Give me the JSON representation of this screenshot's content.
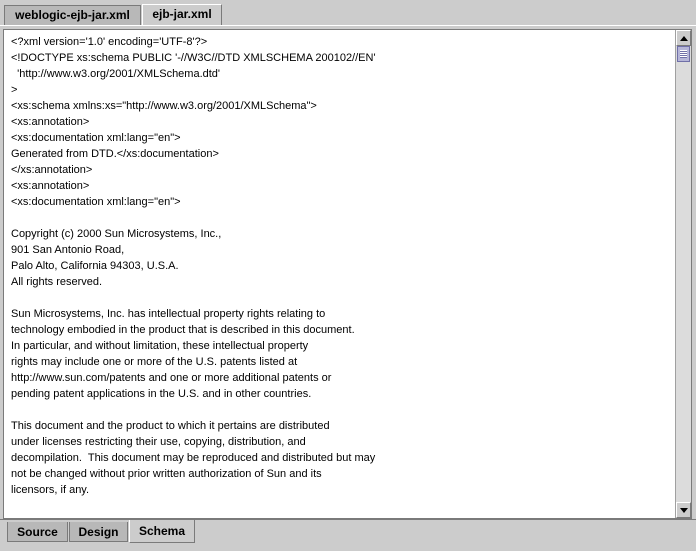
{
  "top_tabs": [
    {
      "label": "weblogic-ejb-jar.xml",
      "selected": false
    },
    {
      "label": "ejb-jar.xml",
      "selected": true
    }
  ],
  "editor": {
    "lines": [
      "<?xml version='1.0' encoding='UTF-8'?>",
      "<!DOCTYPE xs:schema PUBLIC '-//W3C//DTD XMLSCHEMA 200102//EN'",
      "  'http://www.w3.org/2001/XMLSchema.dtd'",
      ">",
      "<xs:schema xmlns:xs=\"http://www.w3.org/2001/XMLSchema\">",
      "<xs:annotation>",
      "<xs:documentation xml:lang=\"en\">",
      "Generated from DTD.</xs:documentation>",
      "</xs:annotation>",
      "<xs:annotation>",
      "<xs:documentation xml:lang=\"en\">",
      "",
      "Copyright (c) 2000 Sun Microsystems, Inc.,",
      "901 San Antonio Road,",
      "Palo Alto, California 94303, U.S.A.",
      "All rights reserved.",
      "",
      "Sun Microsystems, Inc. has intellectual property rights relating to",
      "technology embodied in the product that is described in this document.",
      "In particular, and without limitation, these intellectual property",
      "rights may include one or more of the U.S. patents listed at",
      "http://www.sun.com/patents and one or more additional patents or",
      "pending patent applications in the U.S. and in other countries.",
      "",
      "This document and the product to which it pertains are distributed",
      "under licenses restricting their use, copying, distribution, and",
      "decompilation.  This document may be reproduced and distributed but may",
      "not be changed without prior written authorization of Sun and its",
      "licensors, if any."
    ]
  },
  "scrollbar": {
    "up_icon": "arrow-up-icon",
    "down_icon": "arrow-down-icon"
  },
  "bottom_tabs": [
    {
      "label": "Source",
      "selected": false
    },
    {
      "label": "Design",
      "selected": false
    },
    {
      "label": "Schema",
      "selected": true
    }
  ],
  "colors": {
    "panel": "#cccccc",
    "editor_bg": "#ffffff",
    "scroll_thumb": "#b6b6d8"
  }
}
